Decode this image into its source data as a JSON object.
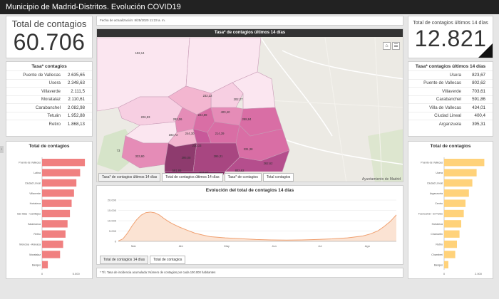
{
  "app": {
    "title": "Municipio de Madrid-Distritos. Evolución COVID19"
  },
  "total_contagios": {
    "label": "Total de contagios",
    "value": "60.706"
  },
  "total_14": {
    "label": "Total de contagios últimos 14 días",
    "value": "12.821"
  },
  "tasa_list": {
    "title": "Tasa* contagios",
    "rows": [
      {
        "name": "Puente de Vallecas",
        "value": "2.635,65"
      },
      {
        "name": "Usera",
        "value": "2.348,63"
      },
      {
        "name": "Villaverde",
        "value": "2.111,5"
      },
      {
        "name": "Moratalaz",
        "value": "2.110,61"
      },
      {
        "name": "Carabanchel",
        "value": "2.082,98"
      },
      {
        "name": "Tetuán",
        "value": "1.952,88"
      },
      {
        "name": "Retiro",
        "value": "1.868,13"
      }
    ]
  },
  "tasa14_list": {
    "title": "Tasa* contagios últimos 14 días",
    "rows": [
      {
        "name": "Usera",
        "value": "823,67"
      },
      {
        "name": "Puente de Vallecas",
        "value": "802,62"
      },
      {
        "name": "Villaverde",
        "value": "703,61"
      },
      {
        "name": "Carabanchel",
        "value": "591,86"
      },
      {
        "name": "Villa de Vallecas",
        "value": "434,01"
      },
      {
        "name": "Ciudad Lineal",
        "value": "400,4"
      },
      {
        "name": "Arganzuela",
        "value": "395,31"
      }
    ]
  },
  "update": {
    "text": "Fecha de actualización: 8/25/2020 11:23 a. m."
  },
  "map": {
    "title": "Tasa* de contagios últimos 14 días",
    "labels": [
      "192,14",
      "232,22",
      "202,27",
      "226,93",
      "282,06",
      "224,89",
      "193,72",
      "244,30",
      "400,40",
      "288,84",
      "230,33",
      "331,38",
      "214,39",
      "395,08",
      "395,31",
      "262,62",
      "73",
      "333,60",
      "591,86",
      "823,67",
      "802,62"
    ],
    "attribution": "Ayuntamiento de Madrid"
  },
  "map_tabs": [
    "Tasa* de contagios últimos 14 días",
    "Total de contagios últimos 14 días",
    "Tasa* de contagios",
    "Total contagios"
  ],
  "left_chart": {
    "title": "Total de contagios",
    "tick_labels": [
      "0",
      "5.000"
    ]
  },
  "right_chart": {
    "title": "Total de contagios",
    "tick_labels": [
      "0",
      "2.000"
    ]
  },
  "line_chart_tabs": [
    "Total de contagios 14 días",
    "Total de contagios"
  ],
  "footnote": {
    "text": "* Tít. Tasa de incidencia acumulada: Número de contagios por cada 100.000 habitantes"
  },
  "chart_data": [
    {
      "type": "bar",
      "title": "Total de contagios",
      "categories": [
        "Puente de Vallecas",
        "Latina",
        "Ciudad Lineal",
        "Villaverde",
        "Hortaleza",
        "San Blas - Canillejas",
        "Salamanca",
        "Retiro",
        "Moncloa - Aravaca",
        "Moratalaz",
        "Barajas"
      ],
      "values": [
        6300,
        5600,
        5050,
        4700,
        4350,
        4100,
        3750,
        3450,
        3100,
        2650,
        850
      ],
      "xlim": [
        0,
        6500
      ],
      "color": "#f08080",
      "orientation": "horizontal"
    },
    {
      "type": "bar",
      "title": "Total de contagios",
      "categories": [
        "Puente de Vallecas",
        "Usera",
        "Ciudad Lineal",
        "Arganzuela",
        "Centro",
        "Fuencarral - El Pardo",
        "Hortaleza",
        "Chamartín",
        "Retiro",
        "Chamberí",
        "Barajas"
      ],
      "values": [
        2350,
        1900,
        1650,
        1450,
        1250,
        1150,
        1000,
        900,
        750,
        650,
        250
      ],
      "xlim": [
        0,
        2500
      ],
      "color": "#ffd27a",
      "orientation": "horizontal"
    },
    {
      "type": "area",
      "title": "Evolución del total de contagios 14 días",
      "y_ticks": [
        "0",
        "5.000",
        "10.000",
        "15.000",
        "20.000"
      ],
      "x_ticks": [
        "Mar",
        "Abr",
        "May",
        "Jun",
        "Jul",
        "Ago"
      ],
      "ylim": [
        0,
        20000
      ],
      "x": [
        0,
        3,
        6,
        9,
        12,
        15,
        18,
        21,
        24,
        27,
        30,
        33,
        36,
        40,
        45,
        50,
        55,
        60,
        70,
        80,
        90,
        100,
        110,
        120,
        130,
        140,
        150,
        160,
        165,
        170,
        174,
        178,
        182
      ],
      "values": [
        200,
        1200,
        4000,
        7500,
        10500,
        12700,
        13900,
        14200,
        13800,
        12700,
        11000,
        9500,
        8300,
        6900,
        5400,
        4000,
        3100,
        2300,
        1700,
        1300,
        900,
        700,
        600,
        700,
        900,
        1200,
        1700,
        2600,
        3600,
        5100,
        7200,
        9600,
        12800
      ],
      "color": "#f0a070"
    }
  ]
}
